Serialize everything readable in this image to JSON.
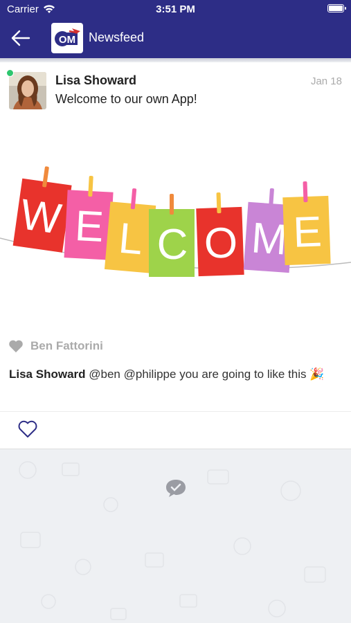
{
  "status_bar": {
    "carrier": "Carrier",
    "time": "3:51 PM"
  },
  "nav": {
    "title": "Newsfeed",
    "logo_text": "OM",
    "back_icon": "arrow-left-icon"
  },
  "post": {
    "author": "Lisa Showard",
    "date": "Jan 18",
    "text": "Welcome to our own App!",
    "banner_letters": [
      "W",
      "E",
      "L",
      "C",
      "O",
      "M",
      "E"
    ],
    "liked_by": "Ben Fattorini",
    "comment": {
      "author": "Lisa Showard",
      "text": "@ben @philippe you are going to like this 🎉"
    }
  },
  "colors": {
    "nav": "#2d2d86",
    "online": "#2dc66e"
  }
}
